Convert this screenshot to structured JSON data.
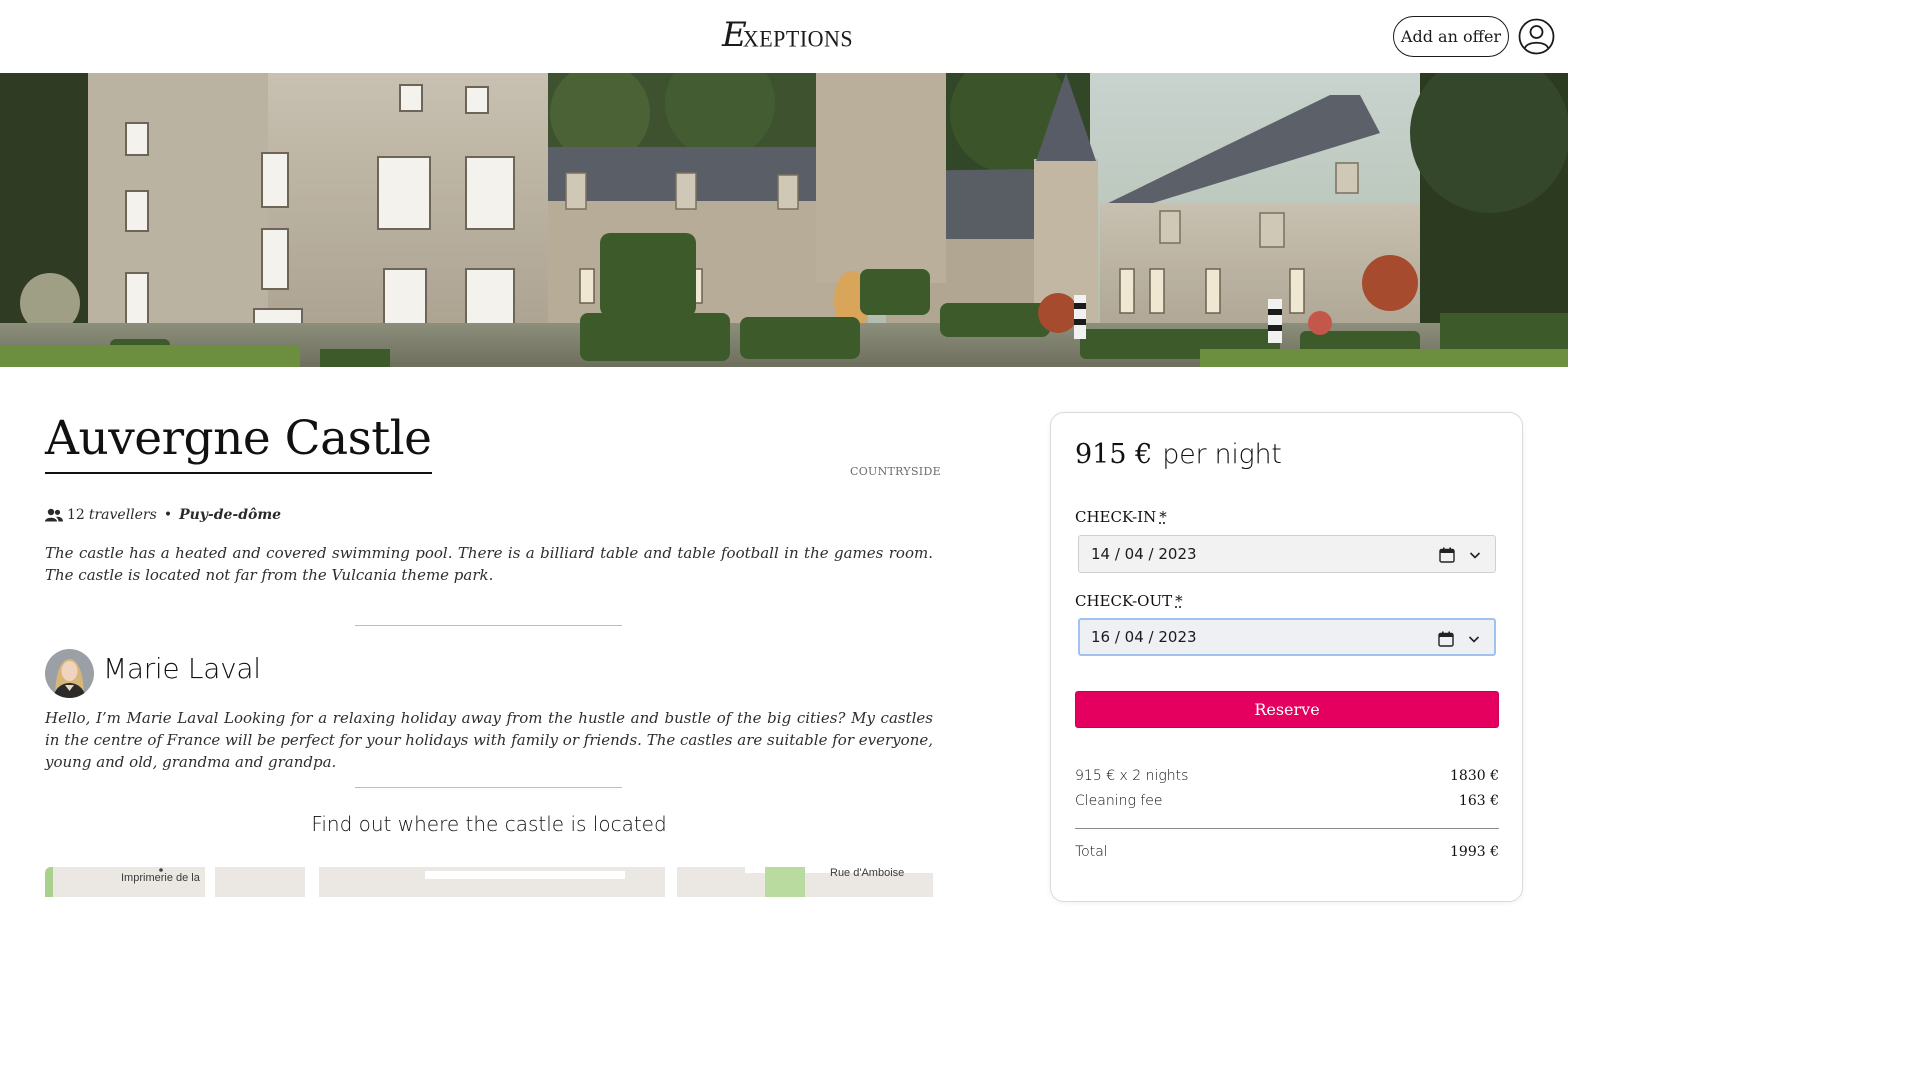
{
  "header": {
    "logo_first": "E",
    "logo_rest": "XEPTIONS",
    "add_offer_label": "Add an offer",
    "user_icon": "user-circle-icon"
  },
  "hero": {
    "alt": "Auvergne Castle photo"
  },
  "listing": {
    "title": "Auvergne Castle",
    "category": "COUNTRYSIDE",
    "travellers_count": "12",
    "travellers_label": "travellers",
    "separator": "•",
    "location": "Puy-de-dôme",
    "description": "The castle has a heated and covered swimming pool. There is a billiard table and table football in the games room. The castle is located not far from the Vulcania theme park."
  },
  "host": {
    "name": "Marie Laval",
    "description": "Hello, I’m Marie Laval Looking for a relaxing holiday away from the hustle and bustle of the big cities? My castles in the centre of France will be perfect for your holidays with family or friends. The castles are suitable for everyone, young and old, grandma and grandpa."
  },
  "map": {
    "heading": "Find out where the castle is located",
    "label_left": "Imprimerie de la",
    "label_right": "Rue d'Amboise"
  },
  "booking": {
    "price_amount": "915 €",
    "price_unit": "per night",
    "checkin_label": "CHECK-IN",
    "checkout_label": "CHECK-OUT",
    "required_mark": "*",
    "checkin_value": "14 / 04 / 2023",
    "checkout_value": "16 / 04 / 2023",
    "reserve_label": "Reserve",
    "nights_label": "915 € x 2 nights",
    "nights_total": "1830 €",
    "cleaning_label": "Cleaning fee",
    "cleaning_total": "163 €",
    "total_label": "Total",
    "total_value": "1993 €"
  },
  "colors": {
    "accent": "#e5005f",
    "text": "#1b1b1b",
    "focus_ring": "#9fc3ee"
  }
}
